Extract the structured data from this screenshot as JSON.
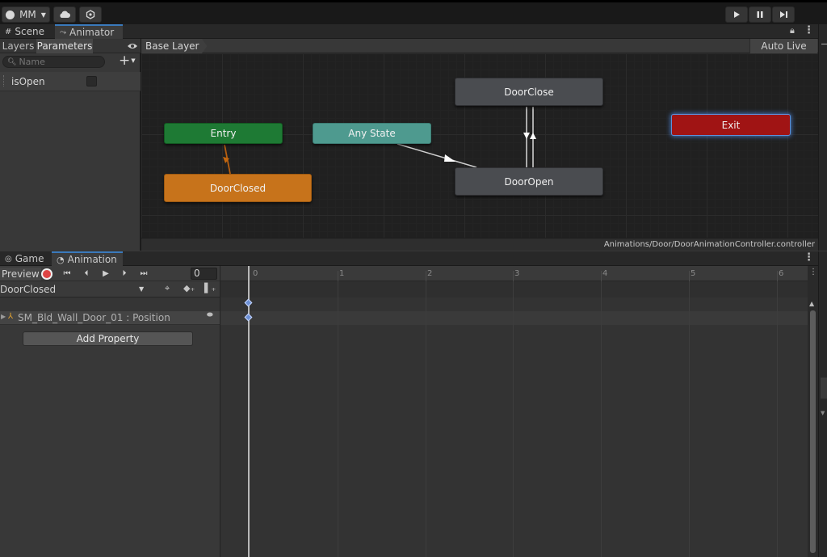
{
  "toolbar": {
    "account_label": "MM",
    "cloud_icon": "cloud-icon",
    "collab_icon": "collab-icon",
    "play_icon": "play-icon",
    "pause_icon": "pause-icon",
    "step_icon": "step-icon"
  },
  "top_tabs": {
    "scene": "Scene",
    "animator": "Animator"
  },
  "animator_left": {
    "tab_layers": "Layers",
    "tab_parameters": "Parameters",
    "search_placeholder": "Name",
    "add_label": "+",
    "parameters": [
      {
        "name": "isOpen",
        "checked": false
      }
    ]
  },
  "animator_header": {
    "breadcrumb": "Base Layer",
    "auto_live_link": "Auto Live Link"
  },
  "graph": {
    "nodes": {
      "entry": "Entry",
      "any_state": "Any State",
      "door_closed": "DoorClosed",
      "door_close": "DoorClose",
      "door_open": "DoorOpen",
      "exit": "Exit"
    },
    "colors": {
      "entry": "#1e7a34",
      "any_state": "#4e9a8f",
      "default_state": "#c7731b",
      "state": "#4a4c50",
      "exit": "#a01414"
    },
    "controller_path": "Animations/Door/DoorAnimationController.controller"
  },
  "bottom_tabs": {
    "game": "Game",
    "animation": "Animation"
  },
  "animation": {
    "preview_label": "Preview",
    "frame_value": "0",
    "clip_name": "DoorClosed",
    "property_label": "SM_Bld_Wall_Door_01 : Position",
    "add_property_label": "Add Property",
    "ruler": [
      "0",
      "1",
      "2",
      "3",
      "4",
      "5",
      "6"
    ]
  }
}
